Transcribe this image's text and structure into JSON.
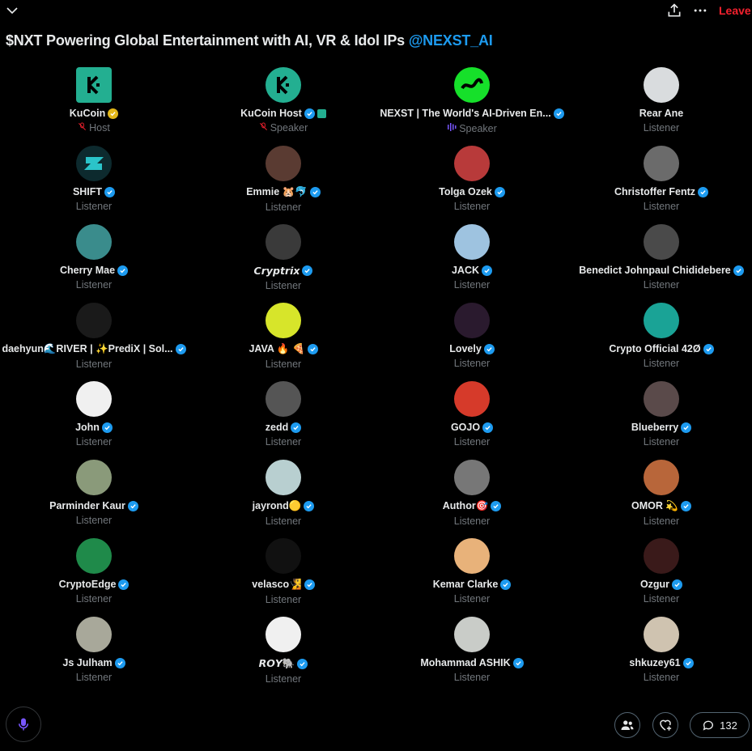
{
  "header": {
    "leave_label": "Leave"
  },
  "space": {
    "title": "$NXT Powering Global Entertainment with AI, VR & Idol IPs",
    "mention": "@NEXST_AI"
  },
  "participants": [
    {
      "name": "KuCoin",
      "role": "Host",
      "role_icon": "mic-off",
      "badge": "gold",
      "avatar_color": "#23af91",
      "avatar_shape": "square"
    },
    {
      "name": "KuCoin Host",
      "role": "Speaker",
      "role_icon": "mic-off",
      "badge": "blue",
      "extra": "kucoin-affiliate",
      "avatar_color": "#23af91"
    },
    {
      "name": "NEXST | The World's AI-Driven En...",
      "role": "Speaker",
      "role_icon": "sound-bars",
      "badge": "blue",
      "avatar_color": "#16e02a"
    },
    {
      "name": "Rear Ane",
      "role": "Listener",
      "badge": "none",
      "avatar_color": "#d9dcde"
    },
    {
      "name": "SHIFT",
      "role": "Listener",
      "badge": "blue",
      "avatar_color": "#0d2a2e"
    },
    {
      "name": "Emmie 🐹🐬",
      "role": "Listener",
      "badge": "blue",
      "avatar_color": "#5a3b32"
    },
    {
      "name": "Tolga Ozek",
      "role": "Listener",
      "badge": "blue",
      "avatar_color": "#b83a3a"
    },
    {
      "name": "Christoffer Fentz",
      "role": "Listener",
      "badge": "blue",
      "avatar_color": "#6b6b6b"
    },
    {
      "name": "Cherry Mae",
      "role": "Listener",
      "badge": "blue",
      "avatar_color": "#3a8c8c"
    },
    {
      "name": "𝘾𝙧𝙮𝙥𝙩𝙧𝙞𝙭",
      "role": "Listener",
      "badge": "blue",
      "avatar_color": "#3a3a3a"
    },
    {
      "name": "JACK",
      "role": "Listener",
      "badge": "blue",
      "avatar_color": "#9ec3e0"
    },
    {
      "name": "Benedict Johnpaul Chididebere",
      "role": "Listener",
      "badge": "blue",
      "avatar_color": "#4a4a4a"
    },
    {
      "name": "daehyun🌊RIVER | ✨PrediX | Sol...",
      "role": "Listener",
      "badge": "blue",
      "avatar_color": "#1a1a1a"
    },
    {
      "name": "JAVA 🔥 🍕",
      "role": "Listener",
      "badge": "blue",
      "avatar_color": "#d7e52a"
    },
    {
      "name": "Lovely",
      "role": "Listener",
      "badge": "blue",
      "avatar_color": "#2a1a2e"
    },
    {
      "name": "Crypto Official 42Ø",
      "role": "Listener",
      "badge": "blue",
      "avatar_color": "#1aa396"
    },
    {
      "name": "John",
      "role": "Listener",
      "badge": "blue",
      "avatar_color": "#f0f0f0"
    },
    {
      "name": "zedd",
      "role": "Listener",
      "badge": "blue",
      "avatar_color": "#555555"
    },
    {
      "name": "GOJO",
      "role": "Listener",
      "badge": "blue",
      "avatar_color": "#d63a2a"
    },
    {
      "name": "Blueberry",
      "role": "Listener",
      "badge": "blue",
      "avatar_color": "#5a4a4a"
    },
    {
      "name": "Parminder Kaur",
      "role": "Listener",
      "badge": "blue",
      "avatar_color": "#8a9a7a"
    },
    {
      "name": "jayrond🟡",
      "role": "Listener",
      "badge": "blue",
      "avatar_color": "#b8cfd0"
    },
    {
      "name": "Author🎯",
      "role": "Listener",
      "badge": "blue",
      "avatar_color": "#777777"
    },
    {
      "name": "OMOR 💫",
      "role": "Listener",
      "badge": "blue",
      "avatar_color": "#b8663a"
    },
    {
      "name": "CryptoEdge",
      "role": "Listener",
      "badge": "blue",
      "avatar_color": "#1f8a4a"
    },
    {
      "name": "velasco🧏",
      "role": "Listener",
      "badge": "blue",
      "avatar_color": "#111111"
    },
    {
      "name": "Kemar Clarke",
      "role": "Listener",
      "badge": "blue",
      "avatar_color": "#e8b27a"
    },
    {
      "name": "Ozgur",
      "role": "Listener",
      "badge": "blue",
      "avatar_color": "#3a1a1a"
    },
    {
      "name": "Js Julham",
      "role": "Listener",
      "badge": "blue",
      "avatar_color": "#a8a89a"
    },
    {
      "name": "𝙍𝙊𝙔🐘",
      "role": "Listener",
      "badge": "blue",
      "avatar_color": "#f0f0f0"
    },
    {
      "name": "Mohammad ASHIK",
      "role": "Listener",
      "badge": "blue",
      "avatar_color": "#c9ccc8"
    },
    {
      "name": "shkuzey61",
      "role": "Listener",
      "badge": "blue",
      "avatar_color": "#cfc3b0"
    }
  ],
  "footer": {
    "comment_count": "132"
  },
  "colors": {
    "accent": "#1d9bf0",
    "leave": "#f4212e",
    "speaker_bars": "#7856ff"
  }
}
